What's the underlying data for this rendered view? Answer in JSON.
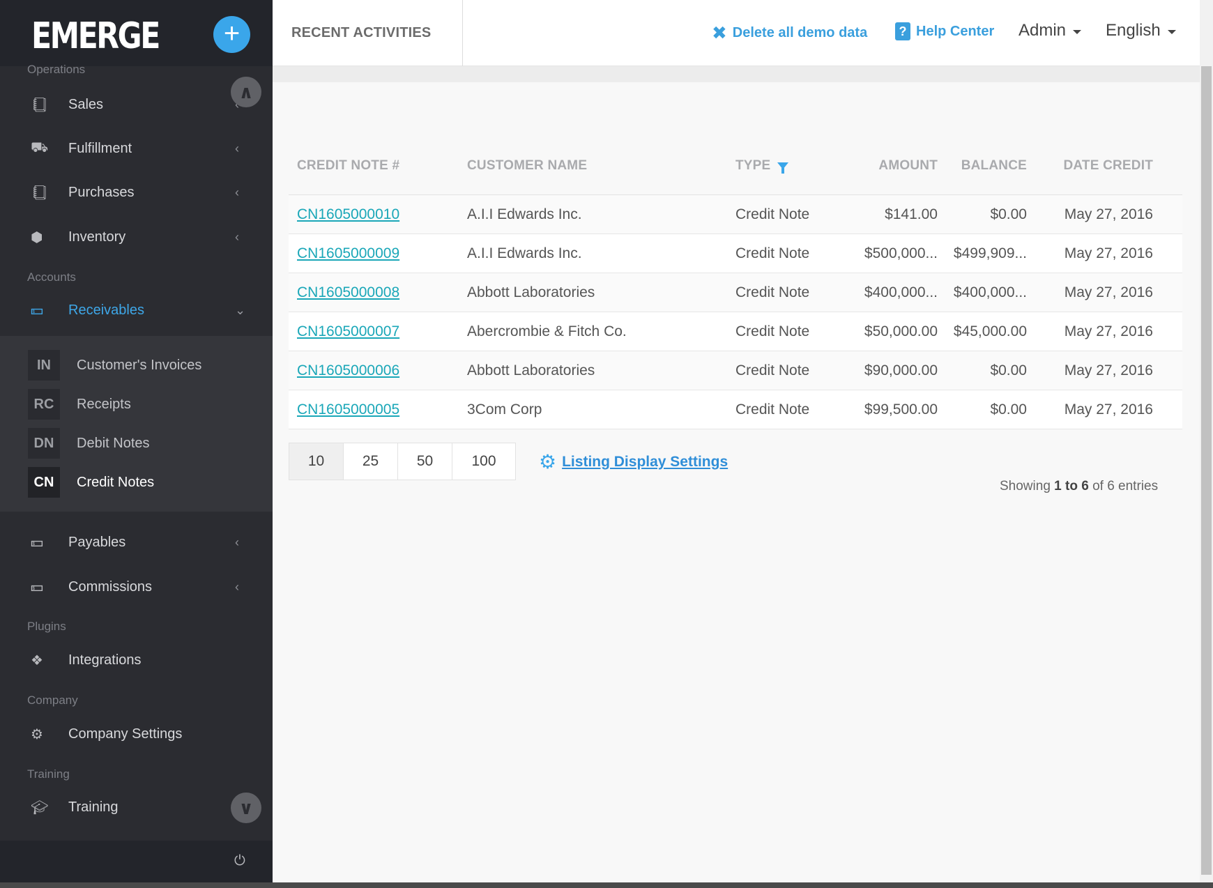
{
  "brand": "EMERGE",
  "add_button": "+",
  "sidebar": {
    "sections": {
      "operations": "Operations",
      "accounts": "Accounts",
      "plugins": "Plugins",
      "company": "Company",
      "training": "Training"
    },
    "items": {
      "sales": "Sales",
      "fulfillment": "Fulfillment",
      "purchases": "Purchases",
      "inventory": "Inventory",
      "receivables": "Receivables",
      "payables": "Payables",
      "commissions": "Commissions",
      "integrations": "Integrations",
      "company_settings": "Company Settings",
      "training": "Training"
    },
    "subitems": [
      {
        "abbr": "IN",
        "label": "Customer's Invoices"
      },
      {
        "abbr": "RC",
        "label": "Receipts"
      },
      {
        "abbr": "DN",
        "label": "Debit Notes"
      },
      {
        "abbr": "CN",
        "label": "Credit Notes"
      }
    ]
  },
  "topbar": {
    "recent": "RECENT ACTIVITIES",
    "delete_demo": "Delete all demo data",
    "help": "Help Center",
    "user": "Admin",
    "language": "English"
  },
  "table": {
    "headers": [
      "CREDIT NOTE #",
      "CUSTOMER NAME",
      "TYPE",
      "AMOUNT",
      "BALANCE",
      "DATE CREDIT"
    ],
    "rows": [
      [
        "CN1605000010",
        "A.I.I Edwards Inc.",
        "Credit Note",
        "$141.00",
        "$0.00",
        "May 27, 2016"
      ],
      [
        "CN1605000009",
        "A.I.I Edwards Inc.",
        "Credit Note",
        "$500,000...",
        "$499,909...",
        "May 27, 2016"
      ],
      [
        "CN1605000008",
        "Abbott Laboratories",
        "Credit Note",
        "$400,000...",
        "$400,000...",
        "May 27, 2016"
      ],
      [
        "CN1605000007",
        "Abercrombie & Fitch Co.",
        "Credit Note",
        "$50,000.00",
        "$45,000.00",
        "May 27, 2016"
      ],
      [
        "CN1605000006",
        "Abbott Laboratories",
        "Credit Note",
        "$90,000.00",
        "$0.00",
        "May 27, 2016"
      ],
      [
        "CN1605000005",
        "3Com Corp",
        "Credit Note",
        "$99,500.00",
        "$0.00",
        "May 27, 2016"
      ]
    ]
  },
  "pager": [
    "10",
    "25",
    "50",
    "100"
  ],
  "settings_link": "Listing Display Settings",
  "info": {
    "prefix": "Showing",
    "range": "1 to 6",
    "suffix": "of 6 entries"
  }
}
